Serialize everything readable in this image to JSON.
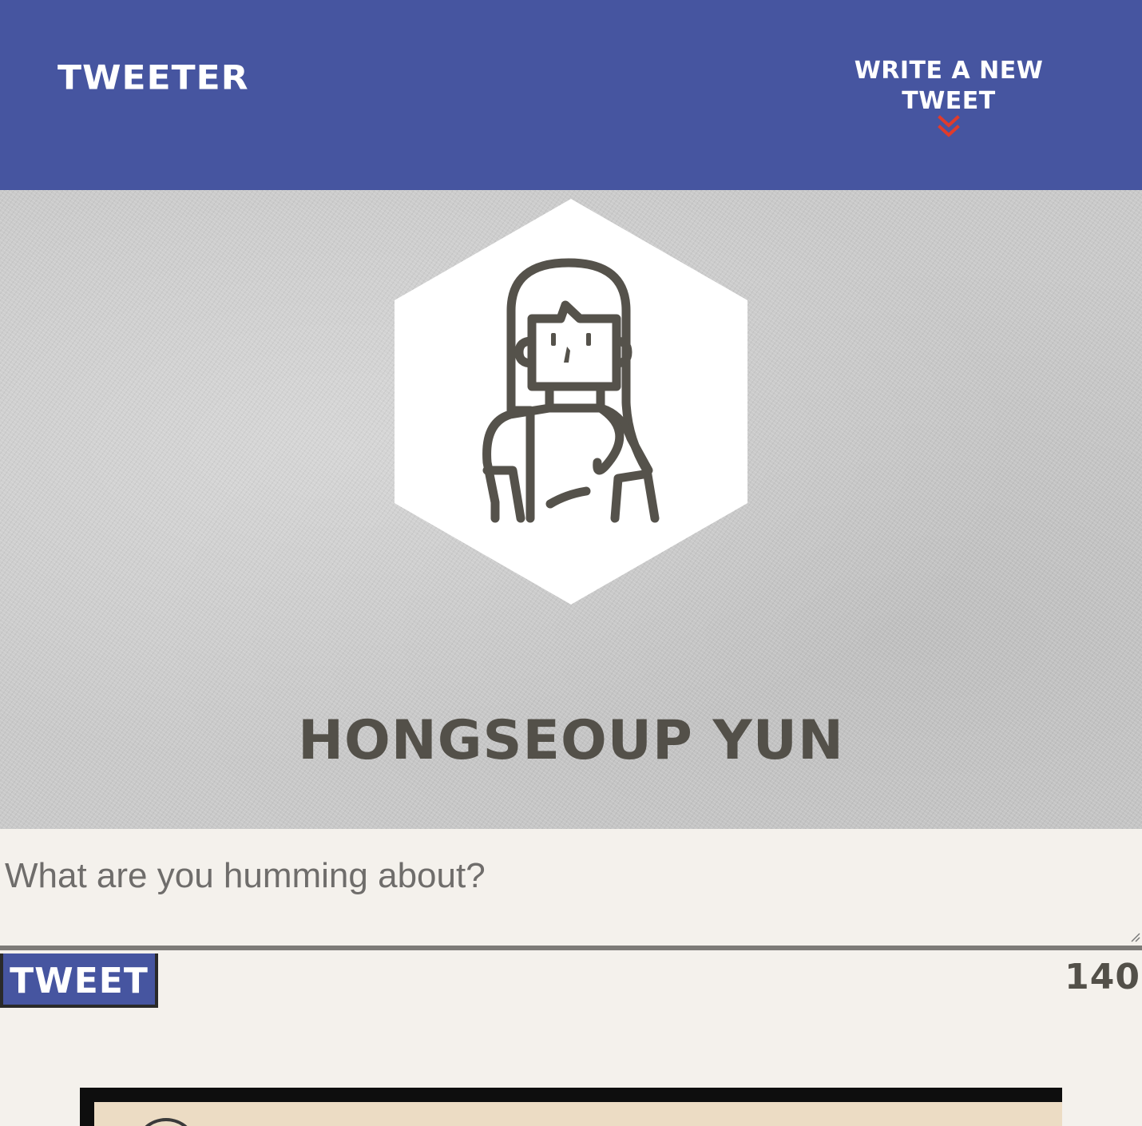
{
  "nav": {
    "brand": "TWEETER",
    "compose_toggle_label": "WRITE A NEW TWEET",
    "compose_toggle_icon": "double-chevron-down-icon",
    "accent_color": "#e03b2c",
    "background_color": "#4655a0"
  },
  "profile": {
    "avatar_icon": "woman-avatar-icon",
    "name": "HONGSEOUP YUN"
  },
  "compose": {
    "placeholder": "What are you humming about?",
    "value": "",
    "submit_label": "TWEET",
    "char_counter": "140"
  }
}
